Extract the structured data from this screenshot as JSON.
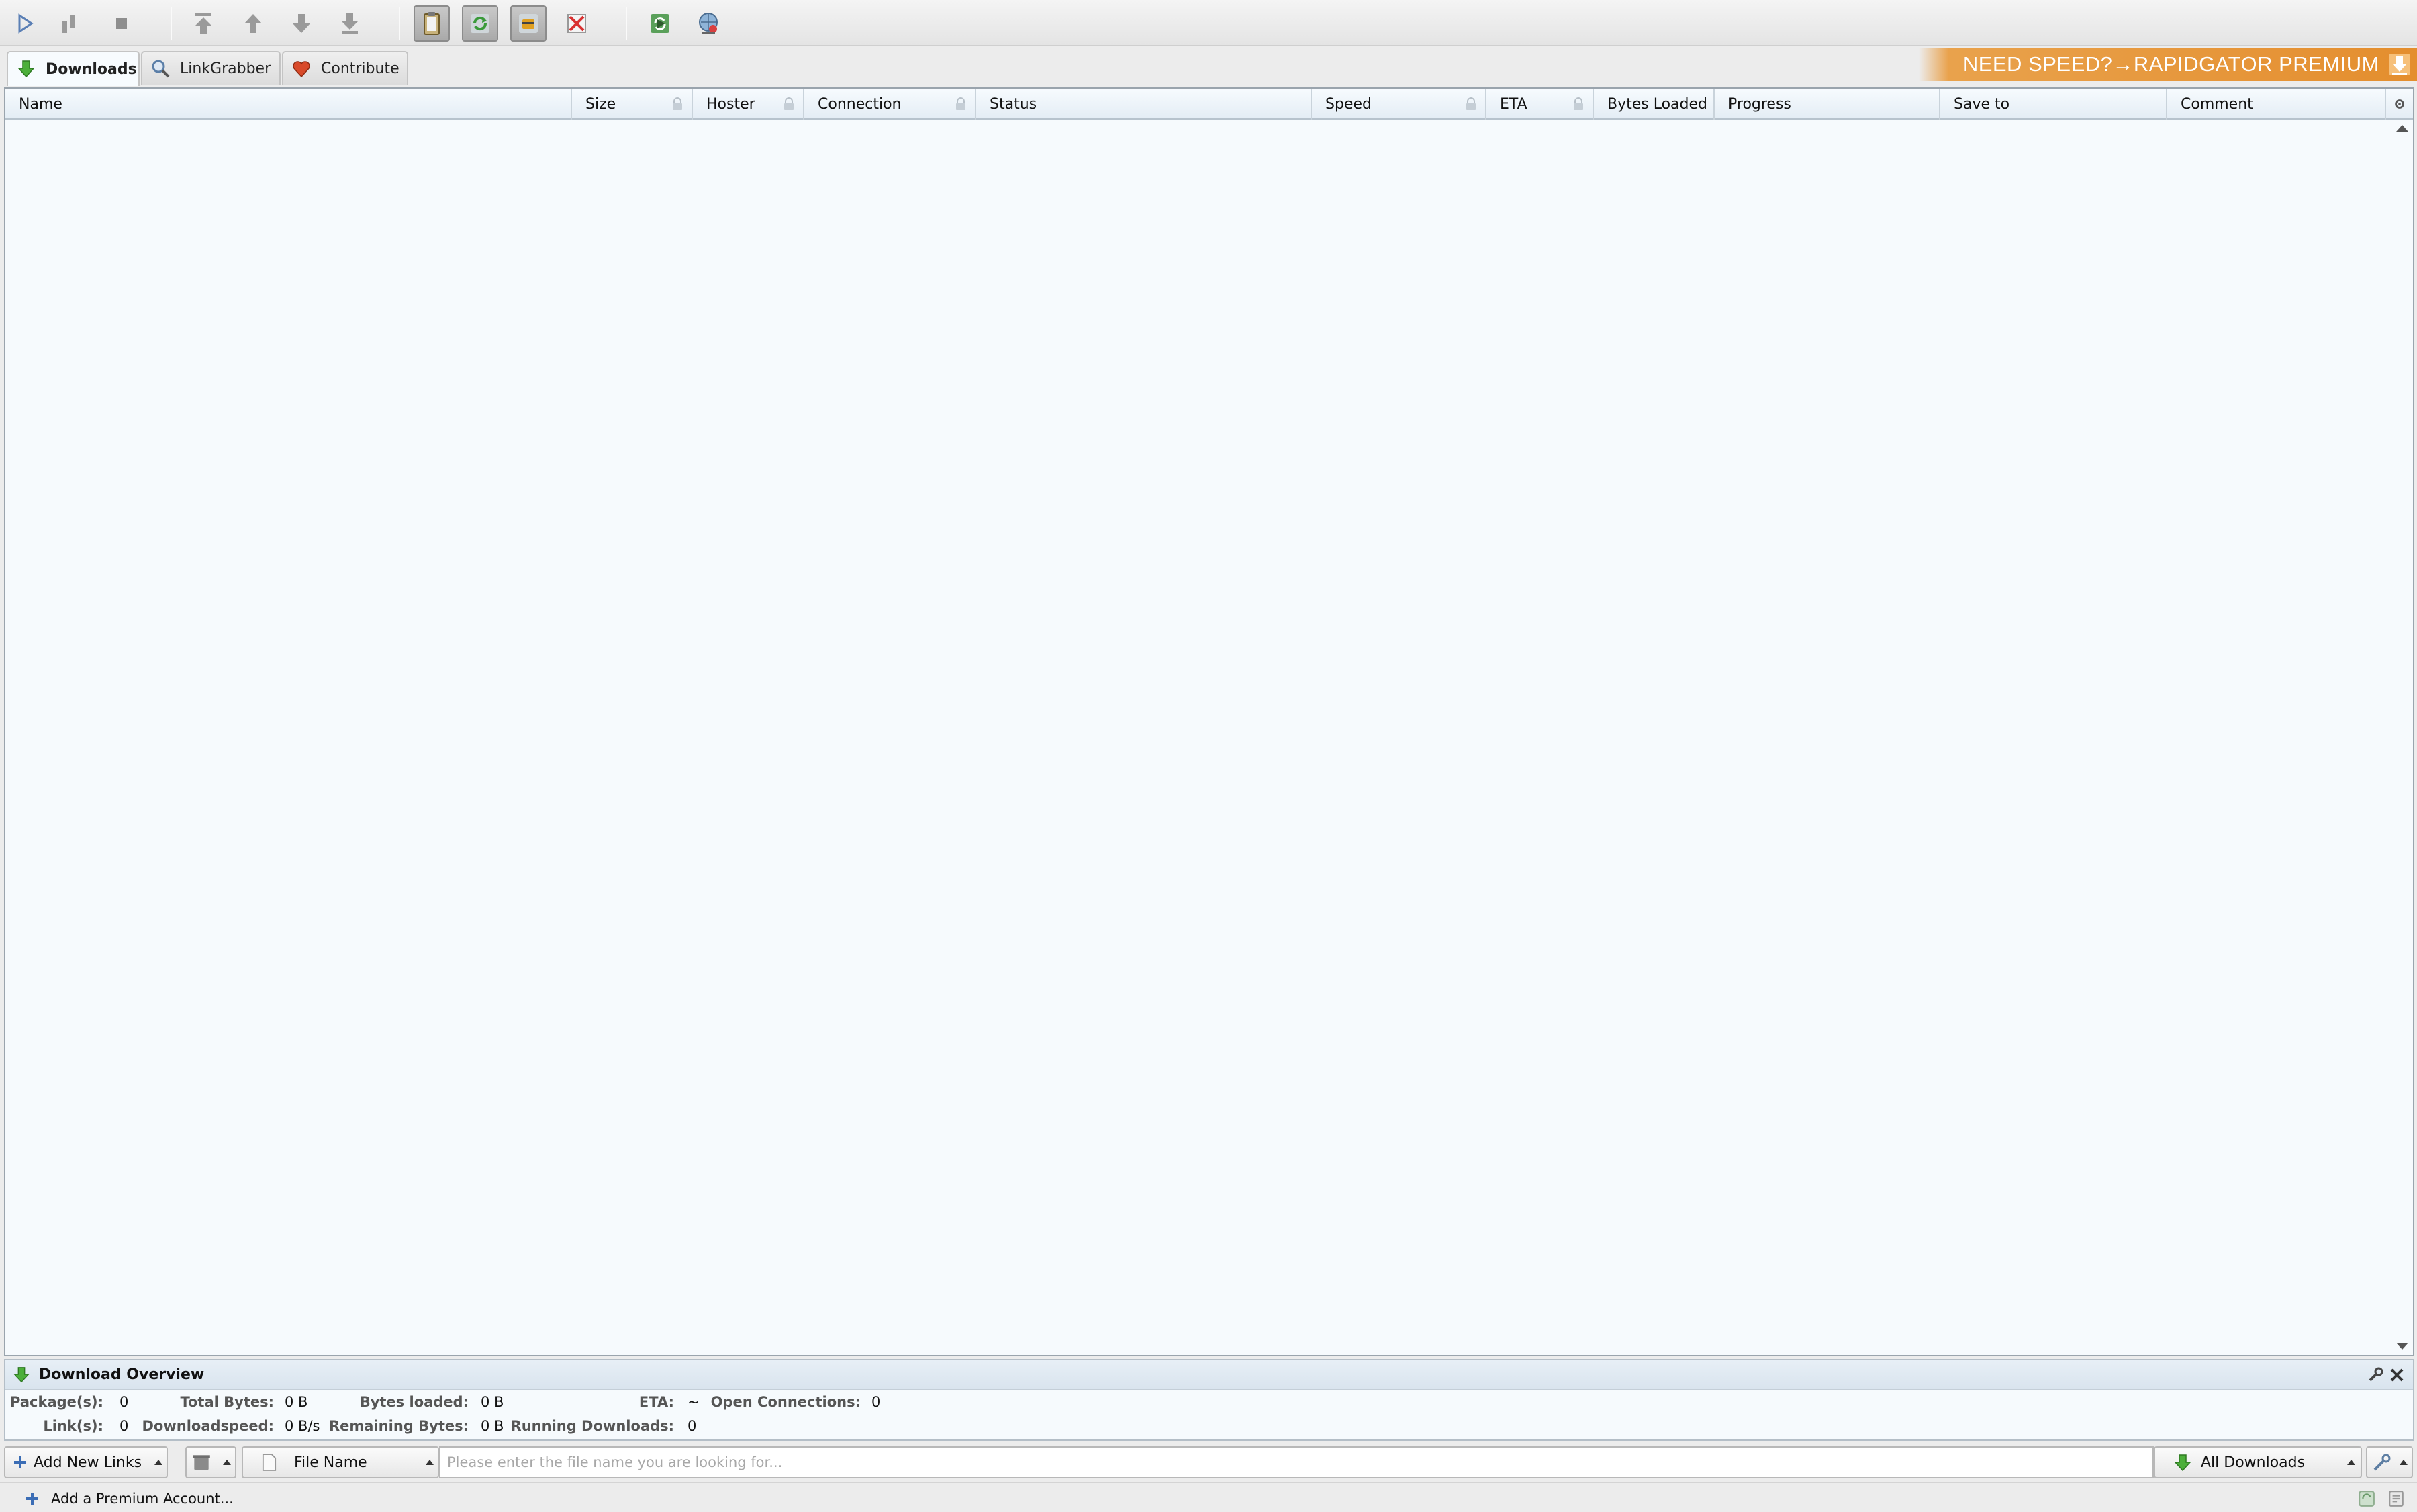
{
  "toolbar": {
    "buttons": [
      {
        "icon": "play-icon",
        "label": "Start Downloads"
      },
      {
        "icon": "pause-icon",
        "label": "Pause Downloads"
      },
      {
        "icon": "stop-icon",
        "label": "Stop Downloads"
      },
      {
        "icon": "move-to-top-icon",
        "label": "Move to top"
      },
      {
        "icon": "move-up-icon",
        "label": "Move up"
      },
      {
        "icon": "move-down-icon",
        "label": "Move down"
      },
      {
        "icon": "move-to-bottom-icon",
        "label": "Move to bottom"
      },
      {
        "icon": "clipboard-observer-icon",
        "label": "Clipboard Observer",
        "pressed": true
      },
      {
        "icon": "auto-reconnect-icon",
        "label": "Auto Reconnect",
        "pressed": true
      },
      {
        "icon": "premium-toggle-icon",
        "label": "Premium",
        "pressed": true
      },
      {
        "icon": "silent-mode-icon",
        "label": "Silent Mode"
      },
      {
        "icon": "reconnect-icon",
        "label": "Reconnect"
      },
      {
        "icon": "update-icon",
        "label": "Update"
      }
    ]
  },
  "tabs": [
    {
      "label": "Downloads",
      "icon": "download-arrow-icon",
      "active": true
    },
    {
      "label": "LinkGrabber",
      "icon": "magnifier-icon",
      "active": false
    },
    {
      "label": "Contribute",
      "icon": "heart-icon",
      "active": false
    }
  ],
  "promo": {
    "text": "NEED SPEED?→RAPIDGATOR PREMIUM",
    "icon": "rapidgator-icon",
    "color": "#e48e2e"
  },
  "table": {
    "columns": [
      {
        "label": "Name",
        "locked": false
      },
      {
        "label": "Size",
        "locked": true
      },
      {
        "label": "Hoster",
        "locked": true
      },
      {
        "label": "Connection",
        "locked": true
      },
      {
        "label": "Status",
        "locked": false
      },
      {
        "label": "Speed",
        "locked": true
      },
      {
        "label": "ETA",
        "locked": true
      },
      {
        "label": "Bytes Loaded",
        "locked": false
      },
      {
        "label": "Progress",
        "locked": false
      },
      {
        "label": "Save to",
        "locked": false
      },
      {
        "label": "Comment",
        "locked": false
      }
    ],
    "rows": []
  },
  "overview": {
    "title": "Download Overview",
    "packages_label": "Package(s):",
    "packages": "0",
    "links_label": "Link(s):",
    "links": "0",
    "total_bytes_label": "Total Bytes:",
    "total_bytes": "0 B",
    "downloadspeed_label": "Downloadspeed:",
    "downloadspeed": "0 B/s",
    "bytes_loaded_label": "Bytes loaded:",
    "bytes_loaded": "0 B",
    "remaining_bytes_label": "Remaining Bytes:",
    "remaining_bytes": "0 B",
    "eta_label": "ETA:",
    "eta": "~",
    "running_downloads_label": "Running Downloads:",
    "running_downloads": "0",
    "open_connections_label": "Open Connections:",
    "open_connections": "0"
  },
  "bottombar": {
    "add_links_label": "Add New Links",
    "search_field_label": "File Name",
    "search_placeholder": "Please enter the file name you are looking for...",
    "view_label": "All Downloads"
  },
  "statusbar": {
    "add_premium_label": "Add a Premium Account..."
  }
}
